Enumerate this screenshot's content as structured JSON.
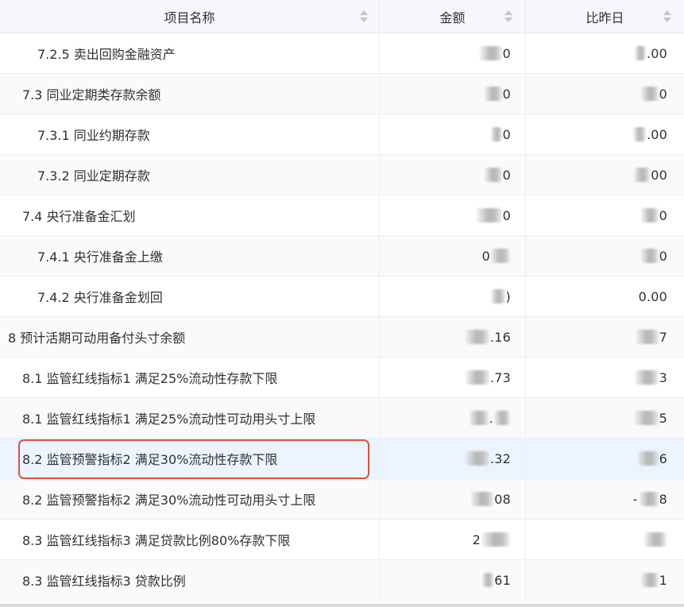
{
  "header": {
    "col_name": "项目名称",
    "col_amount": "金额",
    "col_compare": "比昨日"
  },
  "rows": [
    {
      "name": "7.2.5 卖出回购金融资产",
      "amount": "0",
      "compare": ".00"
    },
    {
      "name": "7.3 同业定期类存款余额",
      "amount": "0",
      "compare": "0"
    },
    {
      "name": "7.3.1 同业约期存款",
      "amount": "0",
      "compare": ".00"
    },
    {
      "name": "7.3.2 同业定期存款",
      "amount": "0",
      "compare": "00"
    },
    {
      "name": "7.4 央行准备金汇划",
      "amount": "0",
      "compare": "0"
    },
    {
      "name": "7.4.1 央行准备金上缴",
      "amount": "0",
      "compare": "0"
    },
    {
      "name": "7.4.2 央行准备金划回",
      "amount": ")",
      "compare": "0.00"
    },
    {
      "name": "8 预计活期可动用备付头寸余额",
      "amount": ".16",
      "compare": "7"
    },
    {
      "name": "8.1 监管红线指标1 满足25%流动性存款下限",
      "amount": ".73",
      "compare": "3"
    },
    {
      "name": "8.1 监管红线指标1 满足25%流动性可动用头寸上限",
      "amount": ".",
      "compare": "5"
    },
    {
      "name": "8.2 监管预警指标2 满足30%流动性存款下限",
      "amount": ".32",
      "compare": "6"
    },
    {
      "name": "8.2 监管预警指标2 满足30%流动性可动用头寸上限",
      "amount": "08",
      "compare": "8"
    },
    {
      "name": "8.3 监管红线指标3 满足贷款比例80%存款下限",
      "amount": "2",
      "compare": ""
    },
    {
      "name": "8.3 监管红线指标3 贷款比例",
      "amount": "61",
      "compare": "1"
    }
  ]
}
